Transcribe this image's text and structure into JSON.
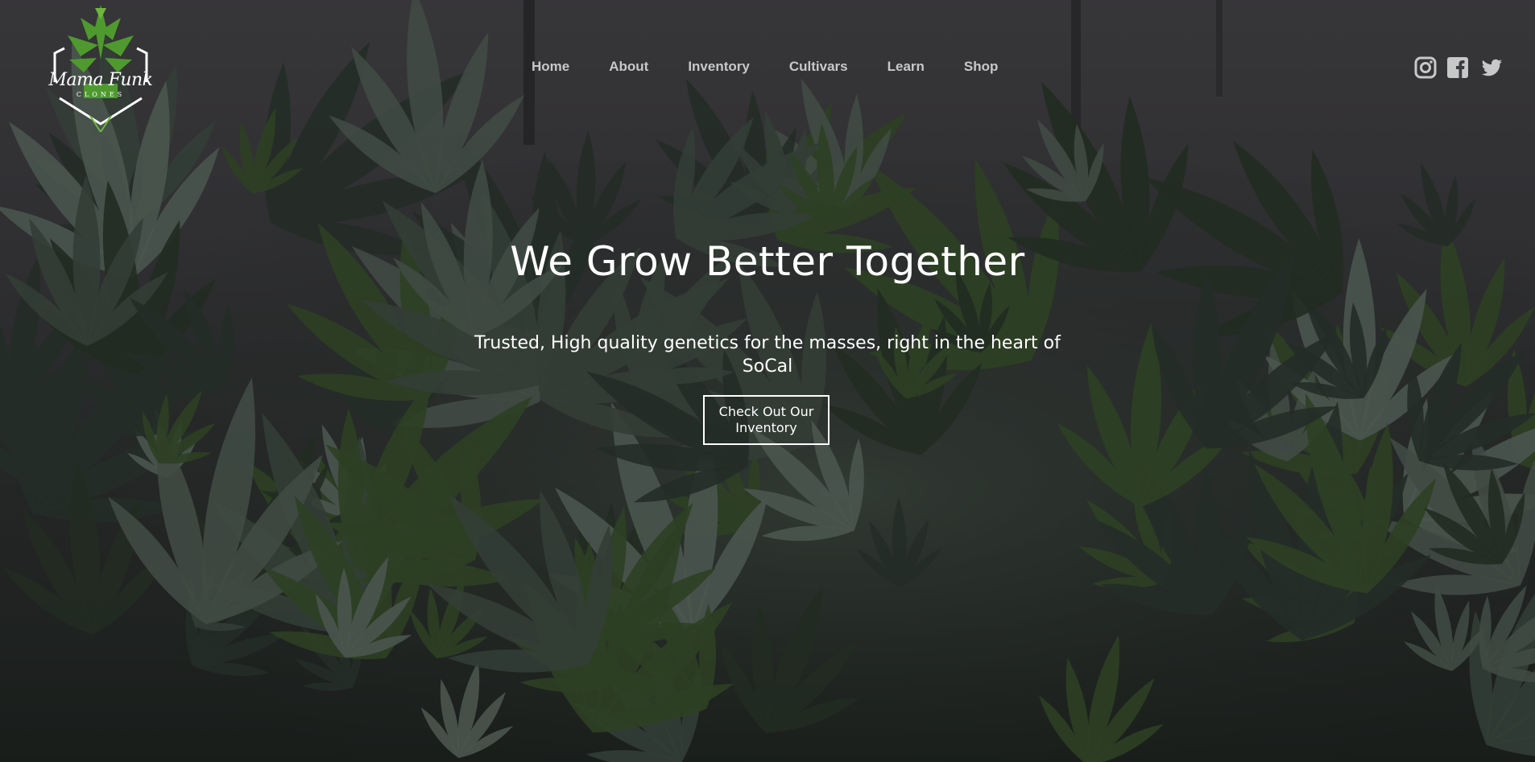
{
  "brand": {
    "name": "Mama Funk",
    "subtitle": "CLONES"
  },
  "nav": {
    "items": [
      {
        "label": "Home"
      },
      {
        "label": "About"
      },
      {
        "label": "Inventory"
      },
      {
        "label": "Cultivars"
      },
      {
        "label": "Learn"
      },
      {
        "label": "Shop"
      }
    ]
  },
  "social": {
    "icons": [
      "instagram-icon",
      "facebook-icon",
      "twitter-icon"
    ]
  },
  "hero": {
    "title": "We Grow Better Together",
    "subtitle": "Trusted, High quality genetics for the masses, right in the heart of SoCal",
    "cta_label": "Check Out Our Inventory"
  },
  "colors": {
    "nav_text": "#c7c9c8",
    "hero_text": "#ffffff",
    "leaf_dark": "#2e3b33",
    "leaf_light": "#5b6b60",
    "leaf_green": "#3c5a2c"
  }
}
